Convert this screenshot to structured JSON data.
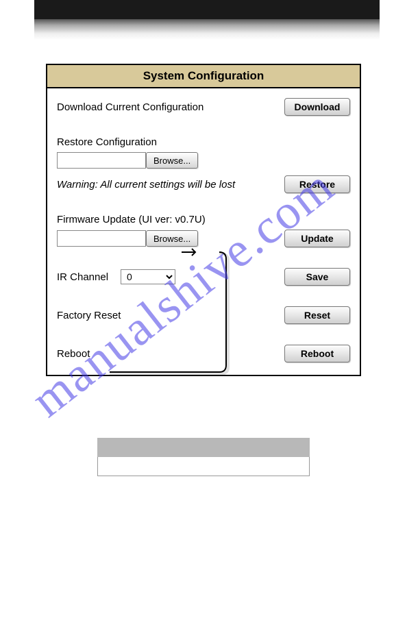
{
  "panel": {
    "title": "System Configuration",
    "download": {
      "label": "Download Current Configuration",
      "button": "Download"
    },
    "restore": {
      "label": "Restore Configuration",
      "browse": "Browse...",
      "warning": "Warning: All current settings will be lost",
      "button": "Restore"
    },
    "firmware": {
      "label": "Firmware Update (UI ver: v0.7U)",
      "browse": "Browse...",
      "button": "Update"
    },
    "ir": {
      "label": "IR Channel",
      "value": "0",
      "button": "Save"
    },
    "factory": {
      "label": "Factory Reset",
      "button": "Reset"
    },
    "reboot": {
      "label": "Reboot",
      "button": "Reboot"
    }
  },
  "watermark": "manualshive.com"
}
